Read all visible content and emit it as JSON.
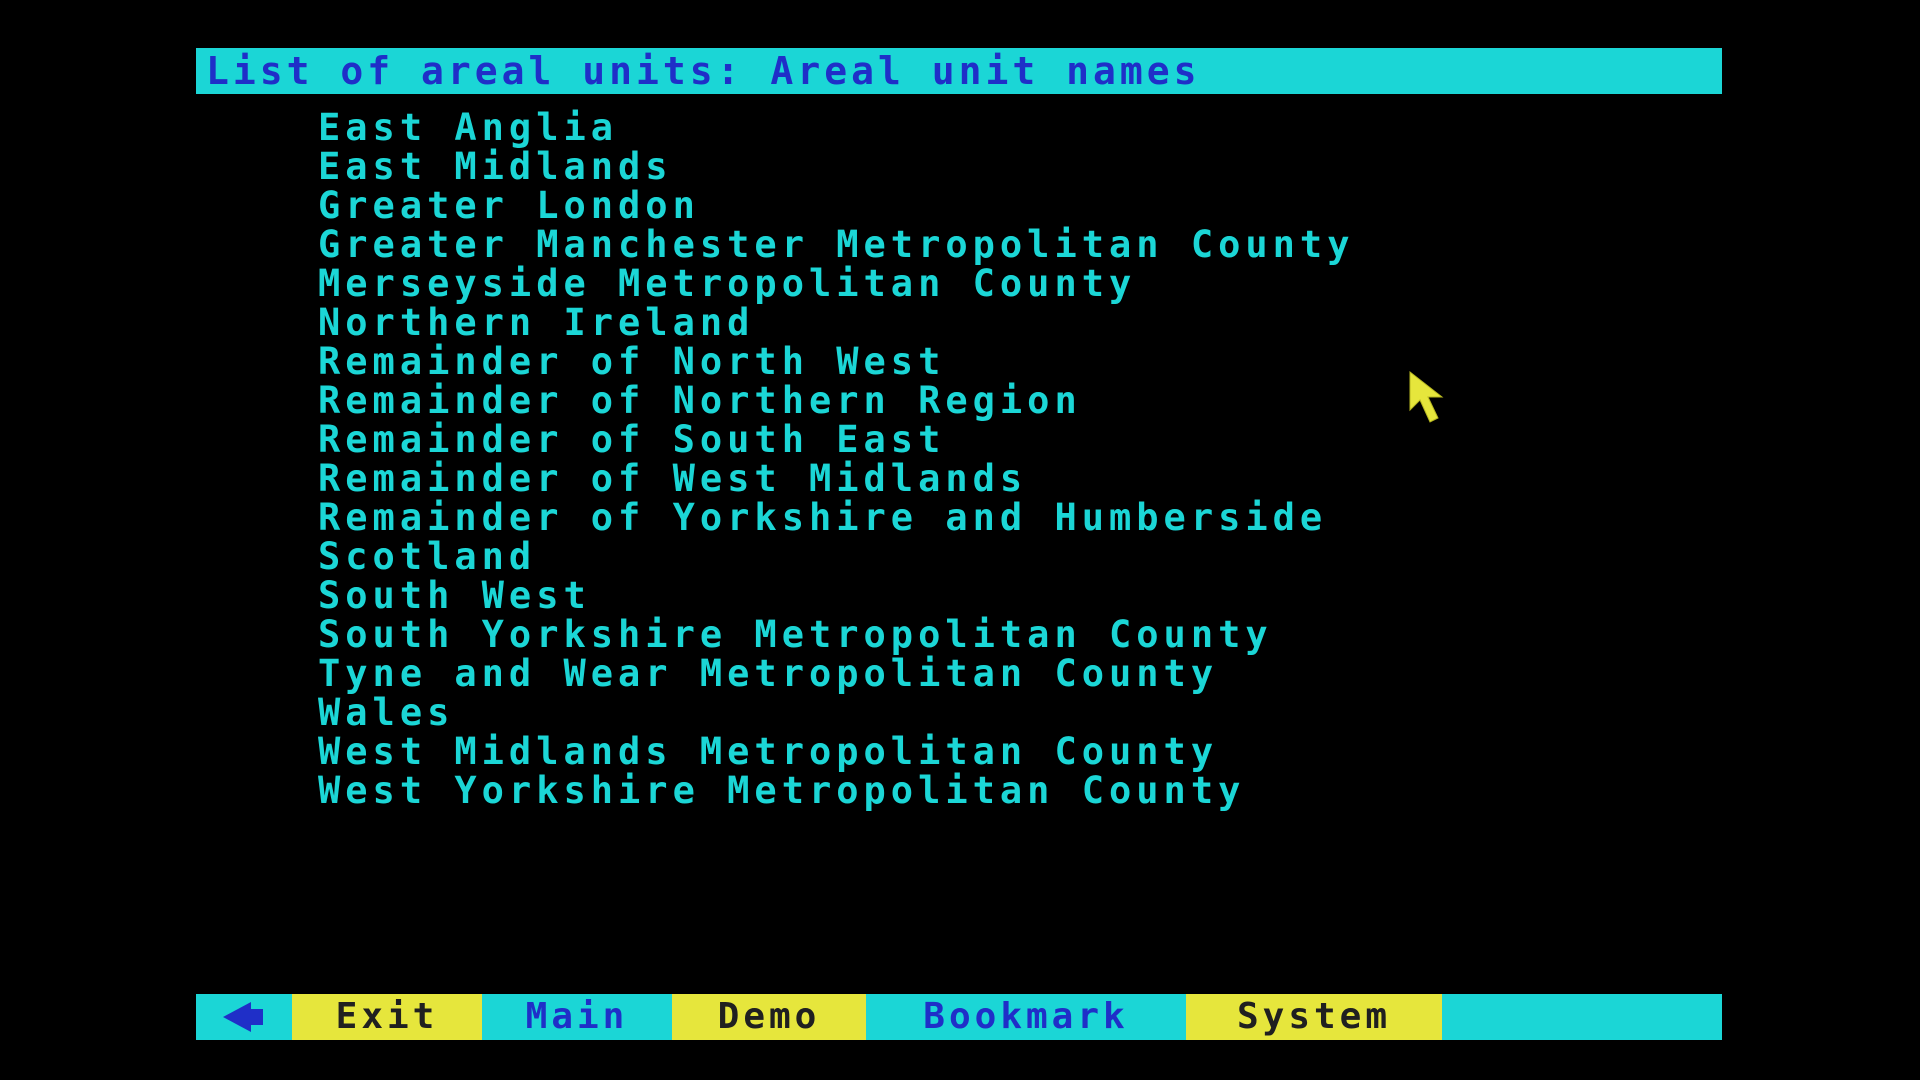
{
  "title": "List of areal units: Areal unit names",
  "areal_units": [
    "East Anglia",
    "East Midlands",
    "Greater London",
    "Greater Manchester Metropolitan County",
    "Merseyside Metropolitan County",
    "Northern Ireland",
    "Remainder of North West",
    "Remainder of Northern Region",
    "Remainder of South East",
    "Remainder of West Midlands",
    "Remainder of Yorkshire and Humberside",
    "Scotland",
    "South West",
    "South Yorkshire Metropolitan County",
    "Tyne and Wear Metropolitan County",
    "Wales",
    "West Midlands Metropolitan County",
    "West Yorkshire Metropolitan County"
  ],
  "menu": {
    "back_icon": "back-arrow-icon",
    "exit": "Exit",
    "main": "Main",
    "demo": "Demo",
    "bookmark": "Bookmark",
    "system": "System"
  },
  "colors": {
    "background": "#000000",
    "cyan": "#1bd6d6",
    "blue_text": "#1f2fc8",
    "yellow": "#e6e63c",
    "pointer": "#e6e63c"
  },
  "pointer_icon": "arrow-pointer-icon"
}
